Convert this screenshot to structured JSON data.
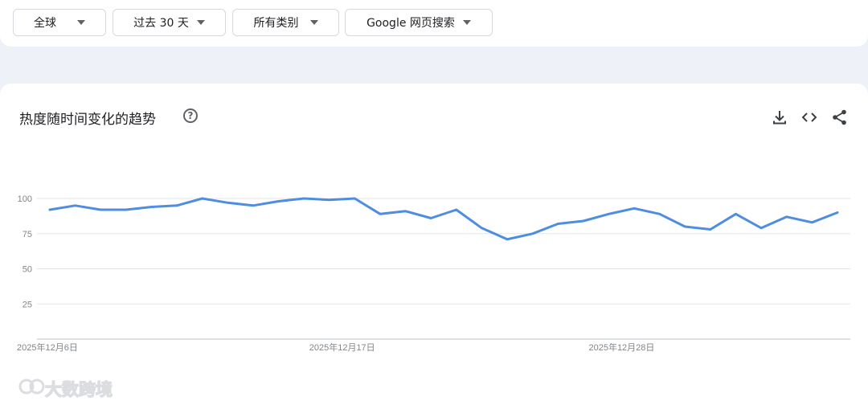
{
  "filters": {
    "region": "全球",
    "time": "过去 30 天",
    "category": "所有类别",
    "search_type": "Google 网页搜索"
  },
  "card": {
    "title": "热度随时间变化的趋势",
    "help_glyph": "?",
    "tools": [
      "download-icon",
      "embed-code-icon",
      "share-icon"
    ]
  },
  "watermark": {
    "text": "大数跨境",
    "icon": "infinity-logo"
  },
  "chart_data": {
    "type": "line",
    "x": [
      "2025-12-06",
      "2025-12-07",
      "2025-12-08",
      "2025-12-09",
      "2025-12-10",
      "2025-12-11",
      "2025-12-12",
      "2025-12-13",
      "2025-12-14",
      "2025-12-15",
      "2025-12-16",
      "2025-12-17",
      "2025-12-18",
      "2025-12-19",
      "2025-12-20",
      "2025-12-21",
      "2025-12-22",
      "2025-12-23",
      "2025-12-24",
      "2025-12-25",
      "2025-12-26",
      "2025-12-27",
      "2025-12-28",
      "2025-12-29",
      "2025-12-30",
      "2025-12-31",
      "2026-01-01",
      "2026-01-02",
      "2026-01-03",
      "2026-01-04",
      "2026-01-05",
      "2026-01-06"
    ],
    "series": [
      {
        "values": [
          92,
          95,
          92,
          92,
          94,
          95,
          100,
          97,
          95,
          98,
          100,
          99,
          100,
          89,
          91,
          86,
          92,
          79,
          71,
          75,
          82,
          84,
          89,
          93,
          89,
          80,
          78,
          89,
          79,
          87,
          83,
          90
        ],
        "color": "#4e8de0"
      }
    ],
    "x_tick_labels": [
      "2025年12月6日",
      "2025年12月17日",
      "2025年12月28日"
    ],
    "y_ticks": [
      100,
      75,
      50,
      25
    ],
    "ylim": [
      0,
      100
    ],
    "grid": true
  }
}
